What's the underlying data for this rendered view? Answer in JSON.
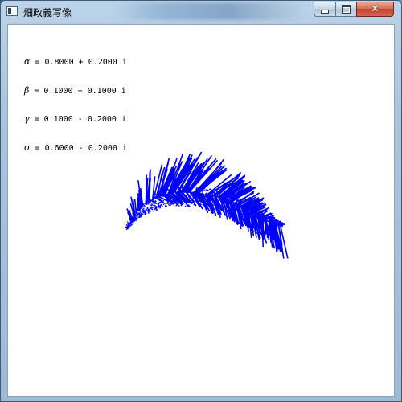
{
  "window": {
    "title": "畑政義写像",
    "controls": {
      "minimize_icon": "minimize-icon",
      "maximize_icon": "maximize-icon",
      "close_icon": "close-icon"
    }
  },
  "parameters": [
    {
      "symbol": "α",
      "eq": " = ",
      "real": "0.8000",
      "sign": " + ",
      "imag": "0.2000",
      "unit": " i"
    },
    {
      "symbol": "β",
      "eq": " = ",
      "real": "0.1000",
      "sign": " + ",
      "imag": "0.1000",
      "unit": " i"
    },
    {
      "symbol": "γ",
      "eq": " = ",
      "real": "0.1000",
      "sign": " - ",
      "imag": "0.2000",
      "unit": " i"
    },
    {
      "symbol": "σ",
      "eq": " = ",
      "real": "0.6000",
      "sign": " - ",
      "imag": "0.2000",
      "unit": " i"
    }
  ],
  "colors": {
    "fractal": "#0000ff",
    "client_background": "#ffffff"
  }
}
